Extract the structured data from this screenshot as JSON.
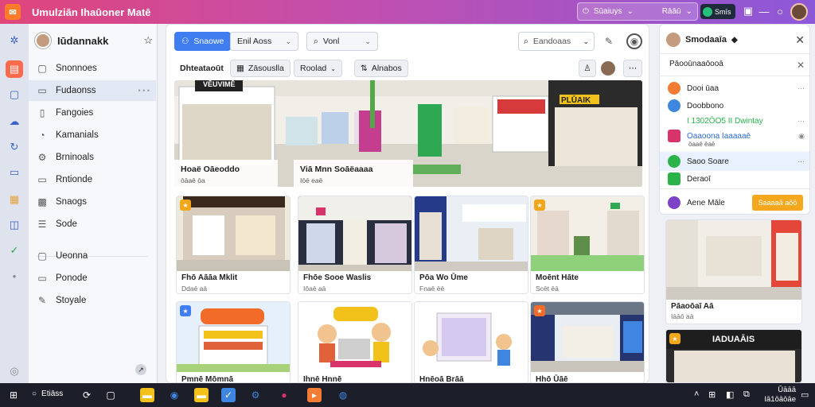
{
  "window": {
    "title": "Umulziān Ihaūoner Matē",
    "account_label": "Sūaiuys",
    "account_extra": "Rāāū",
    "badge_label": "Smīs"
  },
  "sidebar": {
    "title": "Iūdannakk",
    "items": [
      {
        "label": "Snonnoes",
        "icon": "square-icon"
      },
      {
        "label": "Fudaonss",
        "icon": "folder-icon"
      },
      {
        "label": "Fangoies",
        "icon": "file-icon"
      },
      {
        "label": "Kamanials",
        "icon": "user-icon"
      },
      {
        "label": "Brninoals",
        "icon": "gear-icon"
      },
      {
        "label": "Rntionde",
        "icon": "doc-icon"
      },
      {
        "label": "Snaogs",
        "icon": "image-icon"
      },
      {
        "label": "Sode",
        "icon": "list-icon"
      },
      {
        "label": "Ueonna",
        "icon": "square-icon"
      },
      {
        "label": "Ponode",
        "icon": "doc-icon"
      },
      {
        "label": "Stoyale",
        "icon": "brush-icon"
      }
    ]
  },
  "toolbar": {
    "primary_label": "Snaowe",
    "dropdown1_label": "Enil Aoss",
    "dropdown2_label": "Vonl",
    "search_placeholder": "Eandoaas"
  },
  "filters": {
    "title": "Dhteataoūt",
    "chip1": "Zāsouslla",
    "chip2": "Roolad",
    "chip3": "Alnabos"
  },
  "hero": {
    "left_title": "Hoaë Oāeoddo",
    "left_sub": "ōāaē ōa",
    "right_title": "Viā Mnn Soāëaaaa",
    "right_sub": "Iōē eaē",
    "sign_left": "VĒUVIMĒ",
    "sign_right": "PLŪAIK"
  },
  "cards": [
    {
      "title": "Fhō Aāāa Mklit",
      "sub": "Ddaē aā"
    },
    {
      "title": "Fhōe Sooe Waslis",
      "sub": "Iôaē aā"
    },
    {
      "title": "Pōa Wo Ūme",
      "sub": "Fnaē ēē"
    },
    {
      "title": "Moēnt Hāte",
      "sub": "Scēt ēā"
    },
    {
      "title": "Pmnē Mōmnā",
      "sub": ""
    },
    {
      "title": "Ihnē Hnnē",
      "sub": ""
    },
    {
      "title": "Hnēoā Brāā",
      "sub": ""
    },
    {
      "title": "Hhō Ūāē",
      "sub": ""
    }
  ],
  "right_panel": {
    "title": "Smodaaīa",
    "subtitle": "Pāooūnaaōooā",
    "rows": [
      {
        "label": "Dooi ūaa",
        "color": "#f37b34"
      },
      {
        "label": "Doobbono",
        "color": "#3f86e0"
      },
      {
        "label": "I 1302ŌO5 II Dwintay",
        "color": "#2bb34a"
      },
      {
        "label": "Oaaoona Iaaaaaē",
        "color": "#d8336b"
      },
      {
        "label": "Saoo Soare",
        "color": "#2bb34a"
      },
      {
        "label": "Deraoī",
        "color": "#2bb34a"
      },
      {
        "label": "Aene Māle",
        "color": "#7d41c9"
      }
    ],
    "highlight_sub": "ōaaē ēaē",
    "button_label": "Saaaaā aōō",
    "card1_title": "Pāaoōaī Aā",
    "card1_sub": "Iāāō aā",
    "card2_title": "IADUAĀIS"
  },
  "taskbar": {
    "search_label": "Etiāss",
    "clock_time": "Ūāāā",
    "clock_date": "Iā1ōāōāe"
  }
}
